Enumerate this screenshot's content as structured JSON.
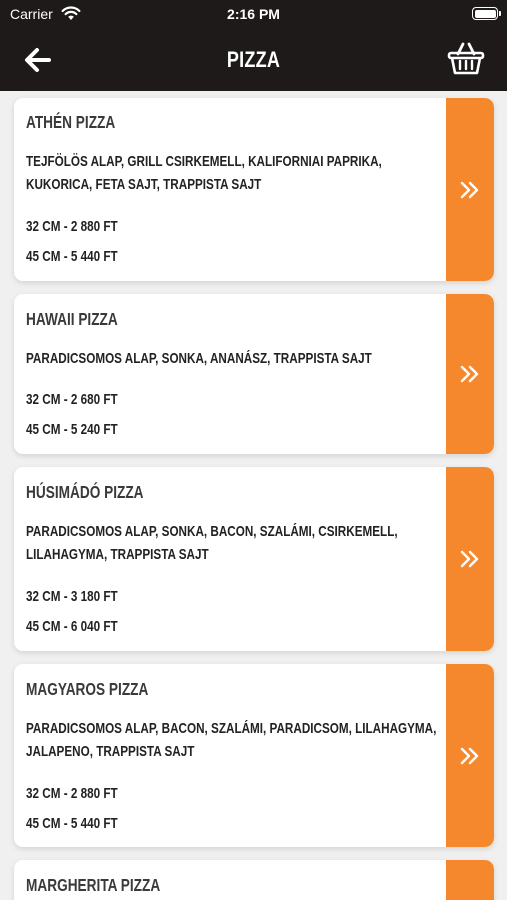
{
  "status_bar": {
    "carrier": "Carrier",
    "time": "2:16 PM"
  },
  "nav": {
    "title": "PIZZA",
    "back_icon": "arrow-left-icon",
    "cart_icon": "basket-icon"
  },
  "colors": {
    "header_bg": "#1e1a1a",
    "accent": "#f5882d",
    "page_bg": "#f0f0f0"
  },
  "items": [
    {
      "name": "ATHÉN PIZZA",
      "description": "TEJFÖLÖS ALAP, GRILL CSIRKEMELL, KALIFORNIAI PAPRIKA, KUKORICA, FETA SAJT, TRAPPISTA SAJT",
      "price_32": "32 CM - 2 880 FT",
      "price_45": "45 CM - 5 440 FT"
    },
    {
      "name": "HAWAII PIZZA",
      "description": "PARADICSOMOS ALAP, SONKA, ANANÁSZ, TRAPPISTA SAJT",
      "price_32": "32 CM - 2 680 FT",
      "price_45": "45 CM - 5 240 FT"
    },
    {
      "name": "HÚSIMÁDÓ PIZZA",
      "description": "PARADICSOMOS ALAP, SONKA, BACON, SZALÁMI, CSIRKEMELL, LILAHAGYMA, TRAPPISTA SAJT",
      "price_32": "32 CM - 3 180 FT",
      "price_45": "45 CM - 6 040 FT"
    },
    {
      "name": "MAGYAROS PIZZA",
      "description": "PARADICSOMOS ALAP, BACON, SZALÁMI, PARADICSOM, LILAHAGYMA, JALAPENO, TRAPPISTA SAJT",
      "price_32": "32 CM - 2 880 FT",
      "price_45": "45 CM - 5 440 FT"
    },
    {
      "name": "MARGHERITA PIZZA"
    }
  ]
}
